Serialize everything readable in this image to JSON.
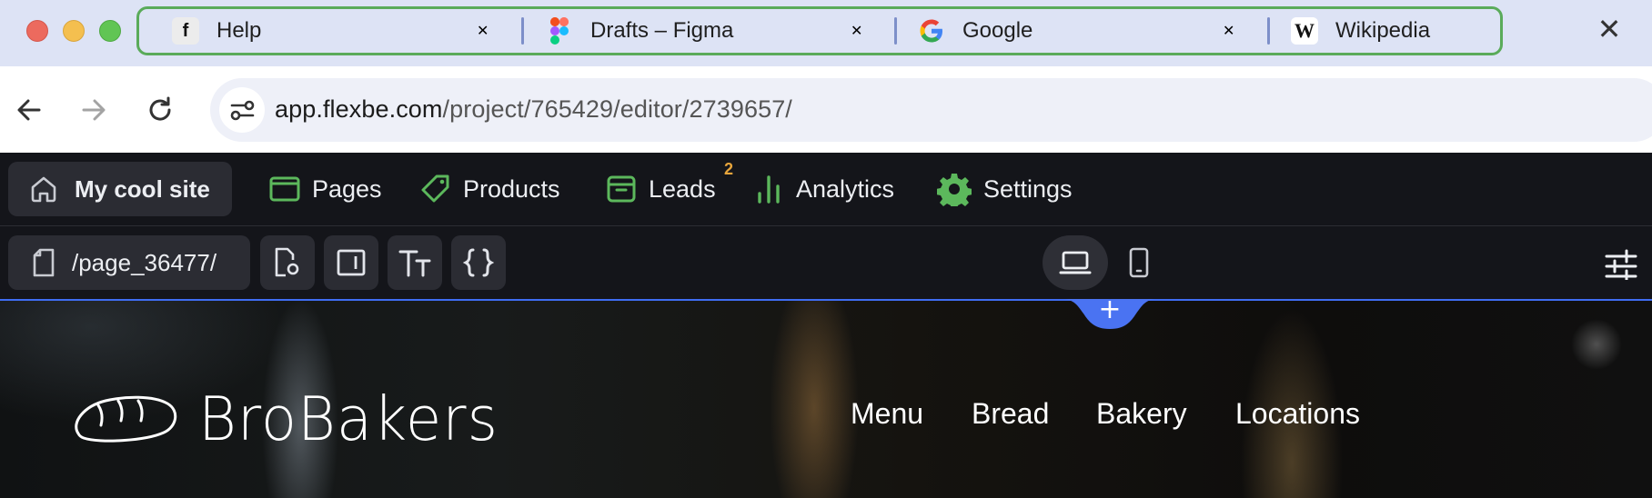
{
  "browser": {
    "tabs": [
      {
        "title": "Help",
        "favicon": "flexbe-icon"
      },
      {
        "title": "Drafts – Figma",
        "favicon": "figma-icon"
      },
      {
        "title": "Google",
        "favicon": "google-icon"
      },
      {
        "title": "Wikipedia",
        "favicon": "wikipedia-icon"
      }
    ],
    "favicon_letters": {
      "flexbe": "f",
      "wikipedia": "W"
    },
    "close_glyph": "✕",
    "tab_group_color": "#5aab5a",
    "address": {
      "host": "app.flexbe.com",
      "path": "/project/765429/editor/2739657/"
    }
  },
  "app_nav": {
    "site_name": "My cool site",
    "items": [
      {
        "label": "Pages",
        "icon": "browser-window-icon"
      },
      {
        "label": "Products",
        "icon": "tag-icon"
      },
      {
        "label": "Leads",
        "icon": "inbox-icon",
        "badge": "2"
      },
      {
        "label": "Analytics",
        "icon": "bar-chart-icon"
      },
      {
        "label": "Settings",
        "icon": "gear-icon"
      }
    ],
    "accent_color": "#5cb85c",
    "badge_color": "#e7a53c"
  },
  "editor_toolbar": {
    "page_path": "/page_36477/",
    "tools": [
      "page-settings-icon",
      "block-frame-icon",
      "text-style-icon",
      "code-braces-icon"
    ],
    "devices": [
      {
        "name": "desktop",
        "icon": "laptop-icon",
        "active": true
      },
      {
        "name": "mobile",
        "icon": "phone-icon",
        "active": false
      }
    ],
    "settings_icon": "sliders-icon",
    "add_block_glyph": "+"
  },
  "site_preview": {
    "brand": "BroBakers",
    "logo_icon": "bread-loaf-icon",
    "menu": [
      "Menu",
      "Bread",
      "Bakery",
      "Locations"
    ]
  }
}
